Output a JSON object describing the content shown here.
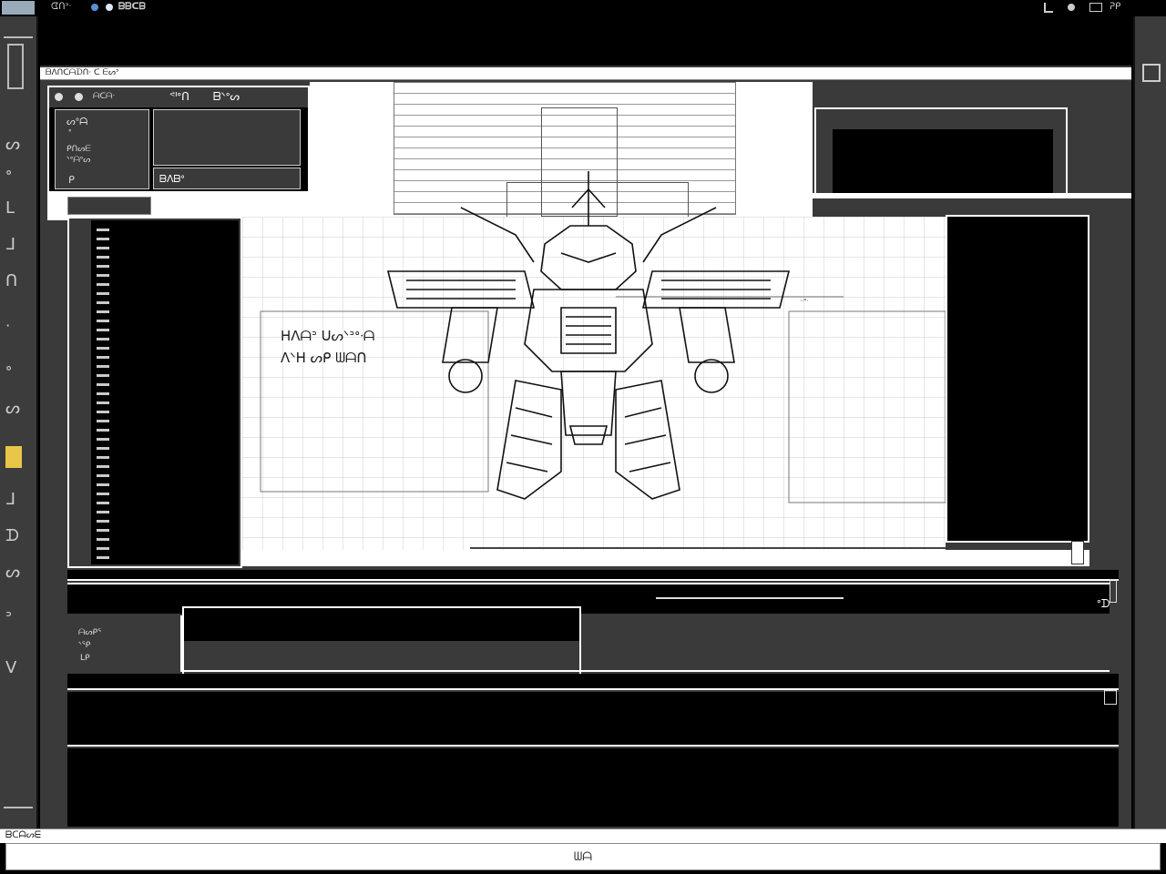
{
  "topbar": {
    "left_label": "ᗧᑎᐣᐧ",
    "center_label": "ᗷᗷᑕᗷ",
    "right_label": "ᕈᑭ"
  },
  "titlestrip": {
    "text": "ᗷᐱᑎᑕᗩᗪᑎ· ᑕ ᗴᔕᐣ"
  },
  "properties_panel": {
    "header_a": "ᗩᑕᗩᐧ",
    "header_b": "ᕝᑊᐤᑎ",
    "header_c": "ᗷᐠᐤᔕ",
    "field_1": "ᔕᐤᗩ",
    "field_1b": "ᐤ",
    "field_2": "ᑭᑎᔕᗴ",
    "field_2b": "ᐠᐤᗩᐤᔕ",
    "field_3": "ᑭ",
    "button_label": "ᗷᐱᗷᐤ"
  },
  "canvas": {
    "annotation_line1": "ᕼᐱᗩᐣ ᑌᔕᐠᐣᐤᐧᗩ",
    "annotation_line2": "ᐱᐠᕼ ᔕᑭ ᗯᗩᑎ",
    "leader_label": "ᐧᐧᐣᐧ"
  },
  "timeline_panel": {
    "label_1": "ᗩᔕᑭᕐ",
    "label_2": "ᐠᕐᑭ",
    "label_3": "ᒪᑭ",
    "side_label": "ᐤᗪ"
  },
  "bottom_strip": {
    "label": "ᗷᑕᗩᔕᗴ"
  },
  "status": {
    "center": "ᗯᗩ"
  }
}
